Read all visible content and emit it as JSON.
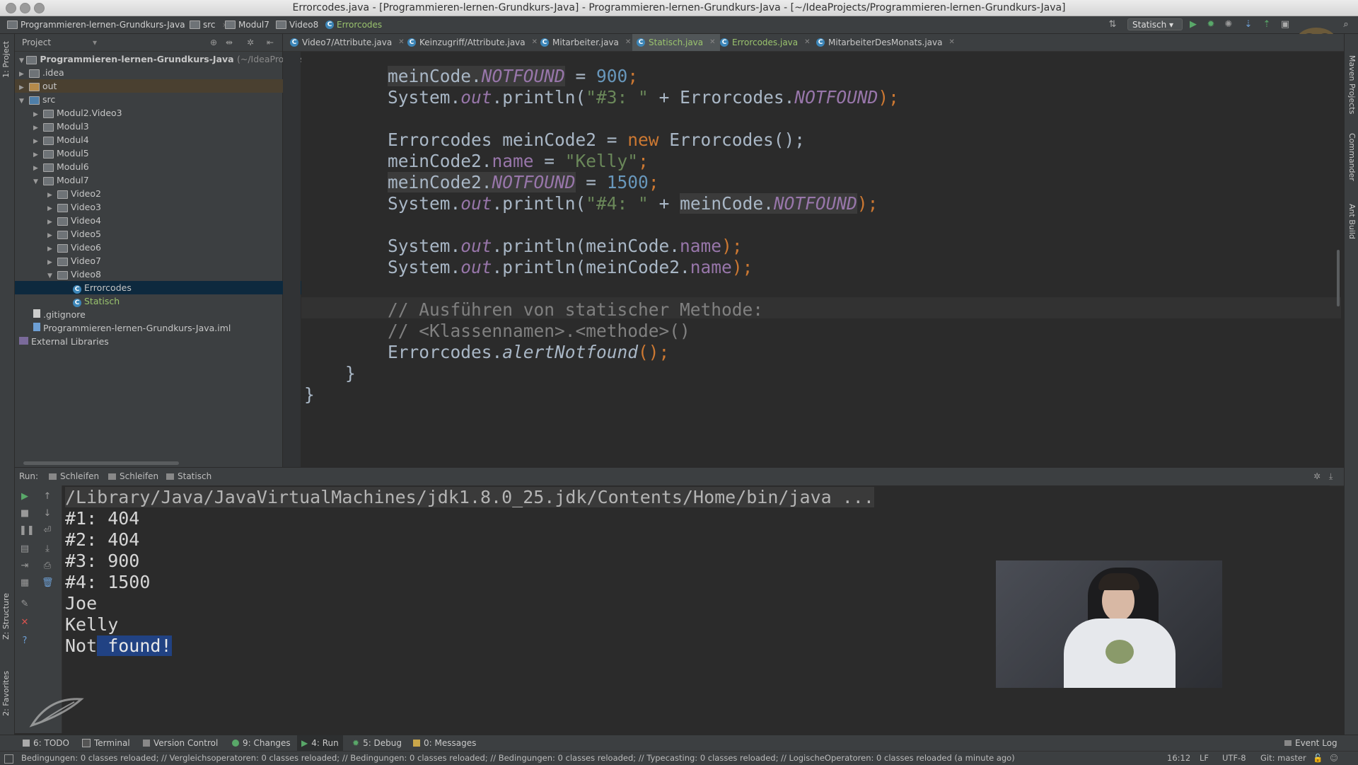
{
  "window": {
    "title": "Errorcodes.java - [Programmieren-lernen-Grundkurs-Java] - Programmieren-lernen-Grundkurs-Java - [~/IdeaProjects/Programmieren-lernen-Grundkurs-Java]"
  },
  "navbar": {
    "crumbs": [
      "Programmieren-lernen-Grundkurs-Java",
      "src",
      "Modul7",
      "Video8",
      "Errorcodes"
    ],
    "run_config": "Statisch"
  },
  "left_tabs": {
    "project": "1: Project",
    "structure": "Z: Structure",
    "favorites": "2: Favorites"
  },
  "right_tabs": {
    "maven": "Maven Projects",
    "commander": "Commander",
    "ant": "Ant Build"
  },
  "project_panel": {
    "title": "Project",
    "root": "Programmieren-lernen-Grundkurs-Java",
    "root_path": "(~/IdeaProjects/P",
    "items": [
      ".idea",
      "out",
      "src",
      "Modul2.Video3",
      "Modul3",
      "Modul4",
      "Modul5",
      "Modul6",
      "Modul7",
      "Video2",
      "Video3",
      "Video4",
      "Video5",
      "Video6",
      "Video7",
      "Video8",
      "Errorcodes",
      "Statisch",
      ".gitignore",
      "Programmieren-lernen-Grundkurs-Java.iml",
      "External Libraries"
    ]
  },
  "editor_tabs": [
    "Video7/Attribute.java",
    "Keinzugriff/Attribute.java",
    "Mitarbeiter.java",
    "Statisch.java",
    "Errorcodes.java",
    "MitarbeiterDesMonats.java"
  ],
  "code": {
    "l1": {
      "a": "meinCode.",
      "f": "NOTFOUND",
      "b": " = ",
      "n": "900",
      "e": ";"
    },
    "l2": {
      "a": "System.",
      "o": "out",
      "b": ".println(",
      "s": "\"#3: \"",
      "c": " + Errorcodes.",
      "f": "NOTFOUND",
      "e": ");"
    },
    "l3": {
      "a": "Errorcodes meinCode2 = ",
      "k": "new",
      "b": " Errorcodes();"
    },
    "l4": {
      "a": "meinCode2.",
      "p": "name",
      "b": " = ",
      "s": "\"Kelly\"",
      "e": ";"
    },
    "l5": {
      "a": "meinCode2.",
      "f": "NOTFOUND",
      "b": " = ",
      "n": "1500",
      "e": ";"
    },
    "l6": {
      "a": "System.",
      "o": "out",
      "b": ".println(",
      "s": "\"#4: \"",
      "c": " + ",
      "h": "meinCode.",
      "f": "NOTFOUND",
      "e": ");"
    },
    "l7": {
      "a": "System.",
      "o": "out",
      "b": ".println(meinCode.",
      "p": "name",
      "e": ");"
    },
    "l8": {
      "a": "System.",
      "o": "out",
      "b": ".println(meinCode2.",
      "p": "name",
      "e": ");"
    },
    "l9": "// Ausführen von statischer Methode:",
    "l10": "// <Klassennamen>.<methode>()",
    "l11": {
      "a": "Errorcodes.",
      "m": "alertNotfound",
      "e": "();"
    },
    "l12": "}",
    "l13": "}"
  },
  "run_panel": {
    "label": "Run:",
    "tabs": [
      "Schleifen",
      "Schleifen",
      "Statisch"
    ]
  },
  "console": {
    "cmd": "/Library/Java/JavaVirtualMachines/jdk1.8.0_25.jdk/Contents/Home/bin/java ...",
    "lines": [
      "#1: 404",
      "#2: 404",
      "#3: 900",
      "#4: 1500",
      "Joe",
      "Kelly"
    ],
    "last_a": "Not",
    "last_b": " found!"
  },
  "bottom_tabs": [
    "6: TODO",
    "Terminal",
    "Version Control",
    "9: Changes",
    "4: Run",
    "5: Debug",
    "0: Messages",
    "Event Log"
  ],
  "status": {
    "message": "Bedingungen: 0 classes reloaded; // Vergleichsoperatoren: 0 classes reloaded; // Bedingungen: 0 classes reloaded; // Bedingungen: 0 classes reloaded; // Typecasting: 0 classes reloaded; // LogischeOperatoren: 0 classes reloaded (a minute ago)",
    "position": "16:12",
    "line_sep": "LF",
    "encoding": "UTF-8",
    "vcs": "Git: master"
  }
}
